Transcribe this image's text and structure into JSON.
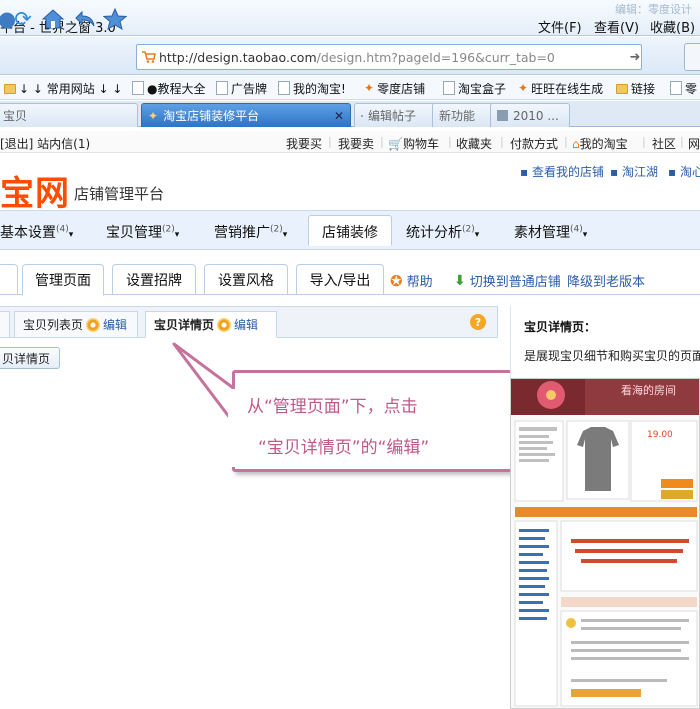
{
  "browser": {
    "title": "平台 - 世界之窗 3.0",
    "editor_note": "编辑：零度设计",
    "menu": [
      "文件(F)",
      "查看(V)",
      "收藏(B)"
    ],
    "url_host": "http://design.taobao.com",
    "url_path": "/design.htm?pageId=196&curr_tab=0",
    "bookmarks": [
      "↓ ↓ 常用网站 ↓ ↓",
      "●教程大全",
      "广告牌",
      "我的淘宝!",
      "零度店铺",
      "淘宝盒子",
      "旺旺在线生成",
      "链接",
      "零"
    ],
    "tabs": [
      "宝贝",
      "淘宝店铺装修平台",
      "编辑帖子",
      "新功能",
      "2010 ..."
    ]
  },
  "site_topbar": {
    "left": "[退出]  站内信(1)",
    "links": [
      "我要买",
      "我要卖",
      "购物车",
      "收藏夹",
      "付款方式",
      "我的淘宝",
      "社区",
      "网"
    ]
  },
  "header": {
    "logo": "宝网",
    "subtitle": "店铺管理平台",
    "links": [
      "查看我的店铺",
      "淘江湖",
      "淘心"
    ]
  },
  "main_nav": {
    "items": [
      "基本设置",
      "宝贝管理",
      "营销推广",
      "店铺装修",
      "统计分析",
      "素材管理"
    ],
    "counts": [
      "(4)",
      "(2)",
      "(2)",
      "",
      "(2)",
      "(4)"
    ]
  },
  "sub_tabs": {
    "items": [
      "管理页面",
      "设置招牌",
      "设置风格",
      "导入/导出"
    ],
    "help": "帮助",
    "switch_link": "切换到普通店铺",
    "downgrade_link": "降级到老版本"
  },
  "page_tabs": {
    "list_page": "宝贝列表页",
    "detail_page": "宝贝详情页",
    "edit": "编辑",
    "detail_button": "贝详情页"
  },
  "callout": {
    "line1": "从“管理页面”下，点击",
    "line2": "“宝贝详情页”的“编辑”"
  },
  "right_panel": {
    "title": "宝贝详情页：",
    "description": "是展现宝贝细节和购买宝贝的页面",
    "banner_text": "看海的房间",
    "price": "19.00"
  },
  "colors": {
    "accent": "#2c74c8",
    "logo": "#ff4d00",
    "callout": "#c5729d",
    "link": "#2a5ca8"
  }
}
